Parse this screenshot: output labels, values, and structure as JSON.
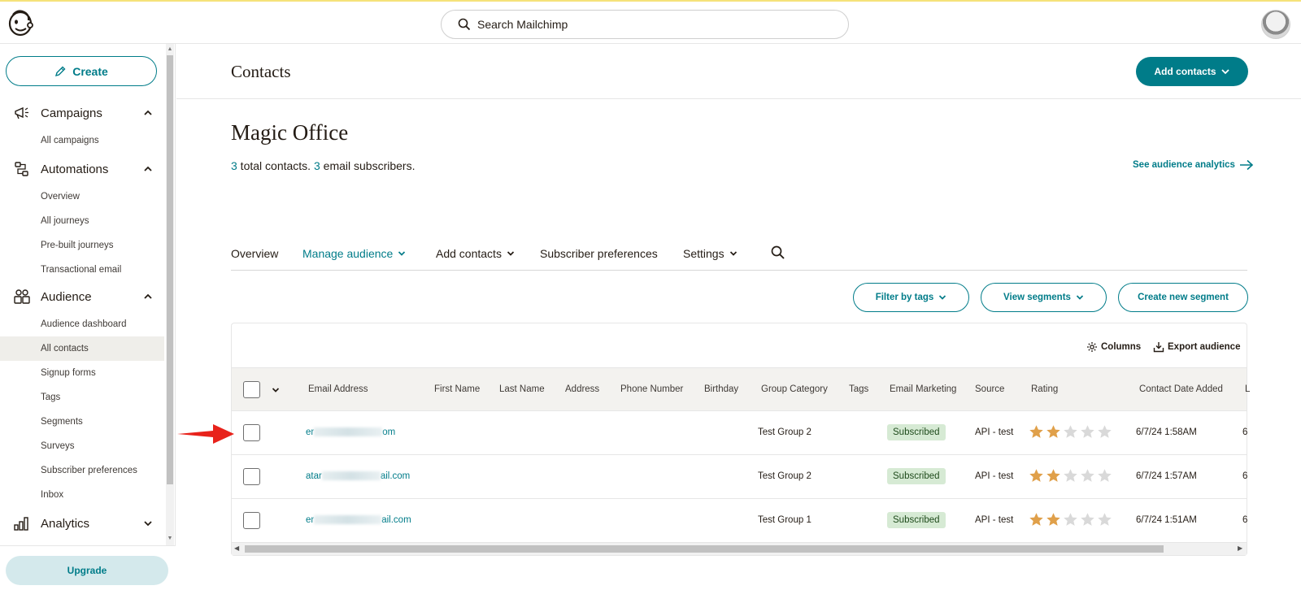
{
  "topbar": {
    "search_placeholder": "Search Mailchimp"
  },
  "sidebar": {
    "create_label": "Create",
    "sections": [
      {
        "label": "Campaigns",
        "icon": "megaphone-icon",
        "items": [
          "All campaigns"
        ]
      },
      {
        "label": "Automations",
        "icon": "flow-icon",
        "items": [
          "Overview",
          "All journeys",
          "Pre-built journeys",
          "Transactional email"
        ]
      },
      {
        "label": "Audience",
        "icon": "audience-icon",
        "items": [
          "Audience dashboard",
          "All contacts",
          "Signup forms",
          "Tags",
          "Segments",
          "Surveys",
          "Subscriber preferences",
          "Inbox"
        ]
      },
      {
        "label": "Analytics",
        "icon": "bar-chart-icon",
        "items": []
      }
    ],
    "active_item": "All contacts",
    "upgrade_label": "Upgrade"
  },
  "header": {
    "title": "Contacts",
    "add_contacts_label": "Add contacts"
  },
  "audience": {
    "name": "Magic Office",
    "total_count": "3",
    "total_text": " total contacts. ",
    "email_count": "3",
    "email_text": " email subscribers.",
    "analytics_link": "See audience analytics"
  },
  "tabs": [
    {
      "label": "Overview",
      "dropdown": false,
      "active": false
    },
    {
      "label": "Manage audience",
      "dropdown": true,
      "active": true
    },
    {
      "label": "Add contacts",
      "dropdown": true,
      "active": false
    },
    {
      "label": "Subscriber preferences",
      "dropdown": false,
      "active": false
    },
    {
      "label": "Settings",
      "dropdown": true,
      "active": false
    }
  ],
  "filters": {
    "filter_by_tags": "Filter by tags",
    "view_segments": "View segments",
    "create_segment": "Create new segment"
  },
  "table_tools": {
    "columns": "Columns",
    "export": "Export audience"
  },
  "table": {
    "headers": [
      "Email Address",
      "First Name",
      "Last Name",
      "Address",
      "Phone Number",
      "Birthday",
      "Group Category",
      "Tags",
      "Email Marketing",
      "Source",
      "Rating",
      "Contact Date Added",
      "L"
    ],
    "rows": [
      {
        "email_start": "er",
        "email_end": "om",
        "group": "Test Group 2",
        "status": "Subscribed",
        "source": "API - test",
        "rating": 2,
        "date": "6/7/24 1:58AM",
        "next": "6"
      },
      {
        "email_start": "atar",
        "email_end": "ail.com",
        "group": "Test Group 2",
        "status": "Subscribed",
        "source": "API - test",
        "rating": 2,
        "date": "6/7/24 1:57AM",
        "next": "6"
      },
      {
        "email_start": "er",
        "email_end": "ail.com",
        "group": "Test Group 1",
        "status": "Subscribed",
        "source": "API - test",
        "rating": 2,
        "date": "6/7/24 1:51AM",
        "next": "6"
      }
    ],
    "rating_max": 5
  },
  "colors": {
    "accent": "#007c89",
    "star_filled": "#e0a04a",
    "star_empty": "#d9d9d9",
    "annotation_arrow": "#e8221b"
  }
}
